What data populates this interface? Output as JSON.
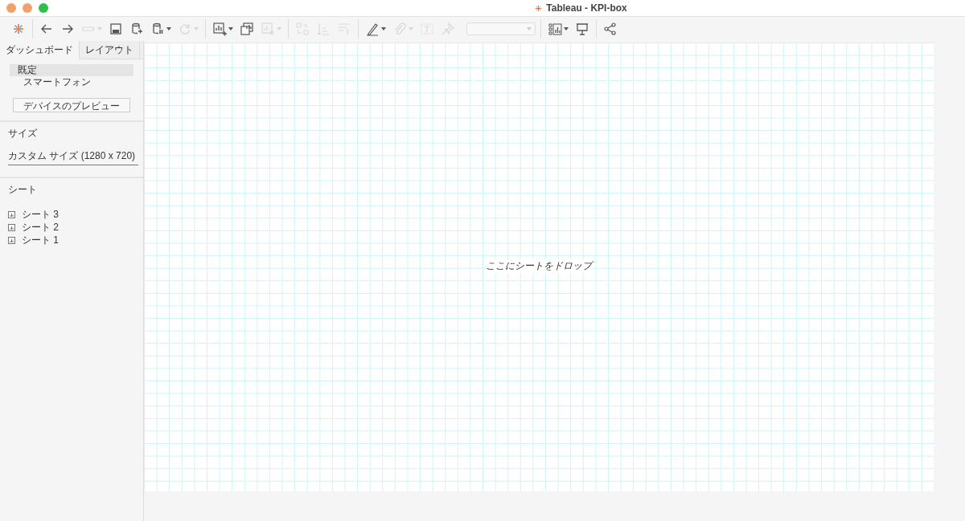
{
  "window": {
    "title": "Tableau - KPI-box"
  },
  "toolbar": {
    "groups": [
      [
        {
          "kind": "button",
          "disabled": false,
          "menu": false
        }
      ],
      [
        {
          "kind": "button",
          "disabled": false,
          "menu": false
        },
        {
          "kind": "button",
          "disabled": false,
          "menu": false
        },
        {
          "kind": "button",
          "disabled": true,
          "menu": true
        },
        {
          "kind": "button",
          "disabled": false,
          "menu": false
        },
        {
          "kind": "button",
          "disabled": false,
          "menu": false
        },
        {
          "kind": "button",
          "disabled": false,
          "menu": true
        },
        {
          "kind": "button",
          "disabled": true,
          "menu": true
        }
      ],
      [
        {
          "kind": "button",
          "disabled": false,
          "menu": true
        },
        {
          "kind": "button",
          "disabled": false,
          "menu": false
        },
        {
          "kind": "button",
          "disabled": true,
          "menu": true
        }
      ],
      [
        {
          "kind": "button",
          "disabled": true,
          "menu": false
        },
        {
          "kind": "button",
          "disabled": true,
          "menu": false
        },
        {
          "kind": "button",
          "disabled": true,
          "menu": false
        }
      ],
      [
        {
          "kind": "button",
          "disabled": false,
          "menu": true
        },
        {
          "kind": "button",
          "disabled": true,
          "menu": true
        },
        {
          "kind": "button",
          "disabled": true,
          "menu": false
        },
        {
          "kind": "button",
          "disabled": true,
          "menu": false
        },
        {
          "kind": "combo",
          "disabled": true,
          "menu": true
        }
      ],
      [
        {
          "kind": "button",
          "disabled": false,
          "menu": true
        },
        {
          "kind": "button",
          "disabled": false,
          "menu": false
        }
      ],
      [
        {
          "kind": "button",
          "disabled": false,
          "menu": false
        }
      ]
    ]
  },
  "sidebar": {
    "tabs": [
      {
        "label": "ダッシュボード",
        "selected": true
      },
      {
        "label": "レイアウト",
        "selected": false
      }
    ],
    "devices": [
      {
        "label": "既定",
        "selected": true
      },
      {
        "label": "スマートフォン",
        "selected": false
      }
    ],
    "preview_button": "デバイスのプレビュー",
    "size": {
      "heading": "サイズ",
      "value": "カスタム サイズ (1280 x 720)"
    },
    "sheets": {
      "heading": "シート",
      "items": [
        "シート 3",
        "シート 2",
        "シート 1"
      ]
    }
  },
  "canvas": {
    "hint": "ここにシートをドロップ"
  }
}
